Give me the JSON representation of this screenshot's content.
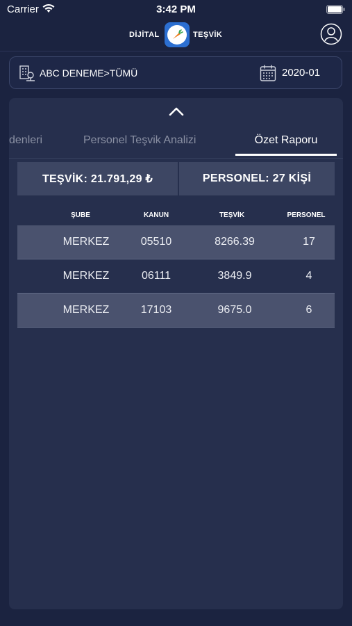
{
  "status_bar": {
    "carrier": "Carrier",
    "time": "3:42 PM"
  },
  "header": {
    "brand_left": "DİJİTAL",
    "brand_right": "TEŞVİK"
  },
  "filter": {
    "branch": "ABC DENEME>TÜMÜ",
    "period": "2020-01"
  },
  "tabs": [
    {
      "label": "Teşvik Nedenleri",
      "visible": "denleri"
    },
    {
      "label": "Personel Teşvik Analizi"
    },
    {
      "label": "Özet Raporu",
      "active": true
    }
  ],
  "summary": {
    "tesvik": "TEŞVİK: 21.791,29 ₺",
    "personel": "PERSONEL: 27 KİŞİ"
  },
  "table": {
    "columns": [
      "ŞUBE",
      "KANUN",
      "TEŞVİK",
      "PERSONEL"
    ],
    "rows": [
      [
        "MERKEZ",
        "05510",
        "8266.39",
        "17"
      ],
      [
        "MERKEZ",
        "06111",
        "3849.9",
        "4"
      ],
      [
        "MERKEZ",
        "17103",
        "9675.0",
        "6"
      ]
    ]
  },
  "colors": {
    "background": "#1b2340",
    "panel": "#262f4d",
    "row_shaded": "#4a526e",
    "summary_box": "#3d4663"
  }
}
